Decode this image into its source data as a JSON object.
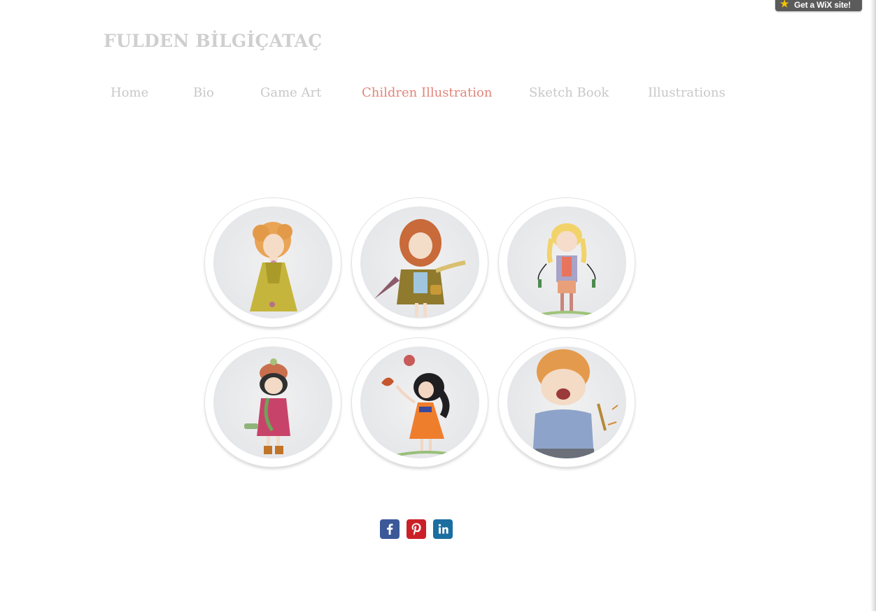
{
  "badge": {
    "label": "Get a WiX site!"
  },
  "site": {
    "title": "FULDEN BİLGİÇATAÇ"
  },
  "nav": {
    "items": [
      {
        "label": "Home"
      },
      {
        "label": "Bio"
      },
      {
        "label": "Game Art"
      },
      {
        "label": "Children Illustration"
      },
      {
        "label": "Sketch Book"
      },
      {
        "label": "Illustrations"
      }
    ],
    "active": "Children Illustration"
  },
  "gallery": {
    "items": [
      {
        "subject": "girl with orange curly hair in yellow dress"
      },
      {
        "subject": "girl with red hair, olive coat and umbrella"
      },
      {
        "subject": "blonde girl with braids and jump rope"
      },
      {
        "subject": "girl with knit hat and pink coat"
      },
      {
        "subject": "dark haired girl in orange dress with butterfly and balloon"
      },
      {
        "subject": "crying boy with red hair holding pencil"
      }
    ]
  },
  "social": [
    {
      "icon": "facebook-icon",
      "color": "#3b5998"
    },
    {
      "icon": "pinterest-icon",
      "color": "#cb2027"
    },
    {
      "icon": "linkedin-icon",
      "color": "#1b6ea0"
    }
  ],
  "colors": {
    "title": "#cfcfcf",
    "nav": "#c8c8c8",
    "nav_active": "#e2857a"
  }
}
